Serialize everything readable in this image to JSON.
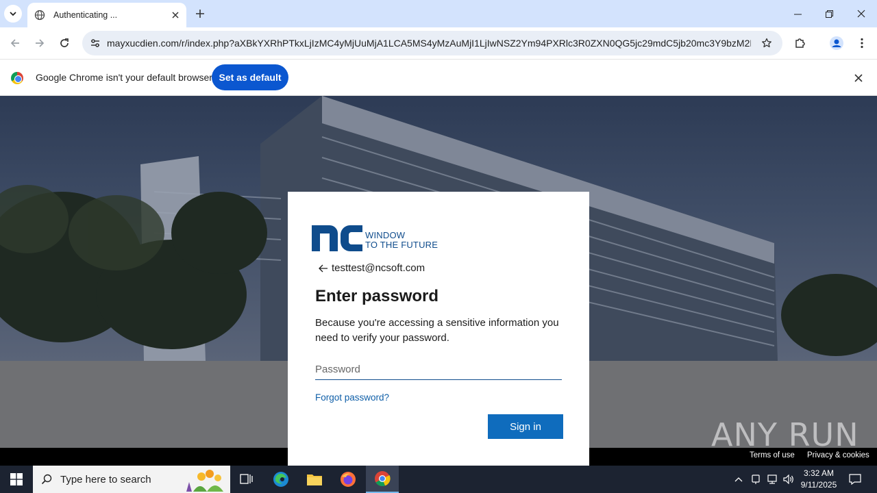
{
  "browser": {
    "tab_title": "Authenticating ...",
    "url": "mayxucdien.com/r/index.php?aXBkYXRhPTkxLjIzMC4yMjUuMjA1LCA5MS4yMzAuMjI1LjIwNSZ2Ym94PXRlc3R0ZXN0QG5jc29mdC5jb20mc3Y9bzM2NV8..."
  },
  "infobar": {
    "message": "Google Chrome isn't your default browser",
    "button_label": "Set as default"
  },
  "login": {
    "logo_line1": "WINDOW",
    "logo_line2": "TO THE FUTURE",
    "identity": "testtest@ncsoft.com",
    "title": "Enter password",
    "description": "Because you're accessing a sensitive information you need to verify your password.",
    "password_placeholder": "Password",
    "forgot_label": "Forgot password?",
    "signin_label": "Sign in",
    "brand_color": "#0f4c8c",
    "button_color": "#0f6cbd"
  },
  "footer": {
    "terms_label": "Terms of use",
    "privacy_label": "Privacy & cookies"
  },
  "watermark": "ANY RUN",
  "taskbar": {
    "search_placeholder": "Type here to search",
    "time": "3:32 AM",
    "date": "9/11/2025"
  },
  "icons": {
    "tab_list": "chevron-down-icon",
    "favicon": "globe-icon",
    "close": "close-icon",
    "new_tab": "plus-icon",
    "back": "arrow-left-icon",
    "forward": "arrow-right-icon",
    "reload": "reload-icon",
    "site_info": "tune-icon",
    "bookmark": "star-icon",
    "extensions": "puzzle-icon",
    "profile": "person-icon",
    "menu": "kebab-icon"
  }
}
